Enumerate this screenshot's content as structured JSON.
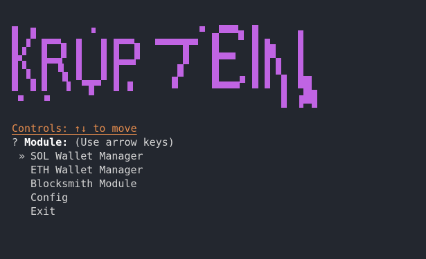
{
  "banner": {
    "text": "KRYPTEIN",
    "color": "#c064e3"
  },
  "controls": {
    "text": "Controls: ↑↓ to move",
    "color": "#e38b4d"
  },
  "prompt": {
    "marker": "?",
    "label": "Module:",
    "hint": "(Use arrow keys)"
  },
  "menu": {
    "pointer": "»",
    "selected_index": 0,
    "items": [
      {
        "label": "SOL Wallet Manager"
      },
      {
        "label": "ETH Wallet Manager"
      },
      {
        "label": "Blocksmith Module"
      },
      {
        "label": "Config"
      },
      {
        "label": "Exit"
      }
    ]
  }
}
